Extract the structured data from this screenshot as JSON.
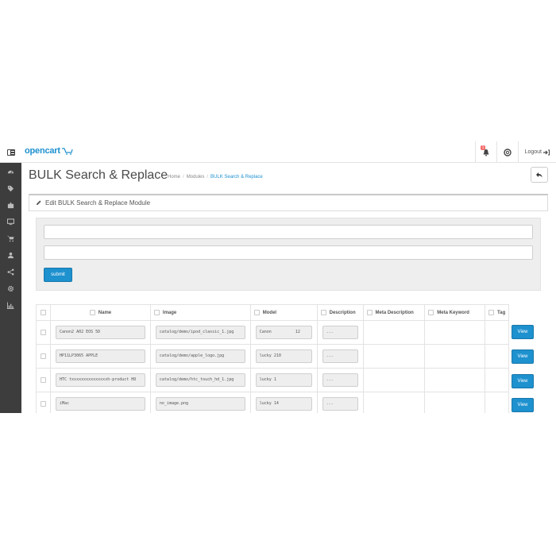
{
  "header": {
    "logo_text": "opencart",
    "notification_count": "1",
    "logout_label": "Logout"
  },
  "sidebar": {
    "icons": [
      "dashboard-icon",
      "tags-icon",
      "puzzle-icon",
      "desktop-icon",
      "cart-icon",
      "user-icon",
      "share-icon",
      "cog-icon",
      "bar-chart-icon"
    ]
  },
  "page": {
    "title": "BULK Search & Replace",
    "breadcrumb": [
      "Home",
      "Modules",
      "BULK Search & Replace"
    ]
  },
  "panel": {
    "title": "Edit BULK Search & Replace Module"
  },
  "form": {
    "search_value": "",
    "replace_value": "",
    "submit_label": "submit"
  },
  "table": {
    "columns": [
      "Name",
      "Image",
      "Model",
      "Description",
      "Meta Description",
      "Meta Keyword",
      "Tag"
    ],
    "rows": [
      {
        "name": "Canon2 A02 EOS 5D",
        "image": "catalog/demo/ipod_classic_1.jpg",
        "model": "Canon          12",
        "description": "...",
        "view": "View"
      },
      {
        "name": "HP11LP3065 APPLE",
        "image": "catalog/demo/apple_logo.jpg",
        "model": "lucky 210",
        "description": "...",
        "view": "View"
      },
      {
        "name": "HTC txxxxxxxxxxxxxxxh-product HD",
        "image": "catalog/demo/htc_touch_hd_1.jpg",
        "model": "lucky 1",
        "description": "...",
        "view": "View"
      }
    ],
    "partial_row": {
      "name": "iMac",
      "image": "no_image.png",
      "model": "lucky 14",
      "description": "...",
      "view": "View"
    }
  },
  "colors": {
    "accent": "#1e91cf",
    "sidebar_bg": "#3d3d3d",
    "badge": "#f56b6b"
  }
}
